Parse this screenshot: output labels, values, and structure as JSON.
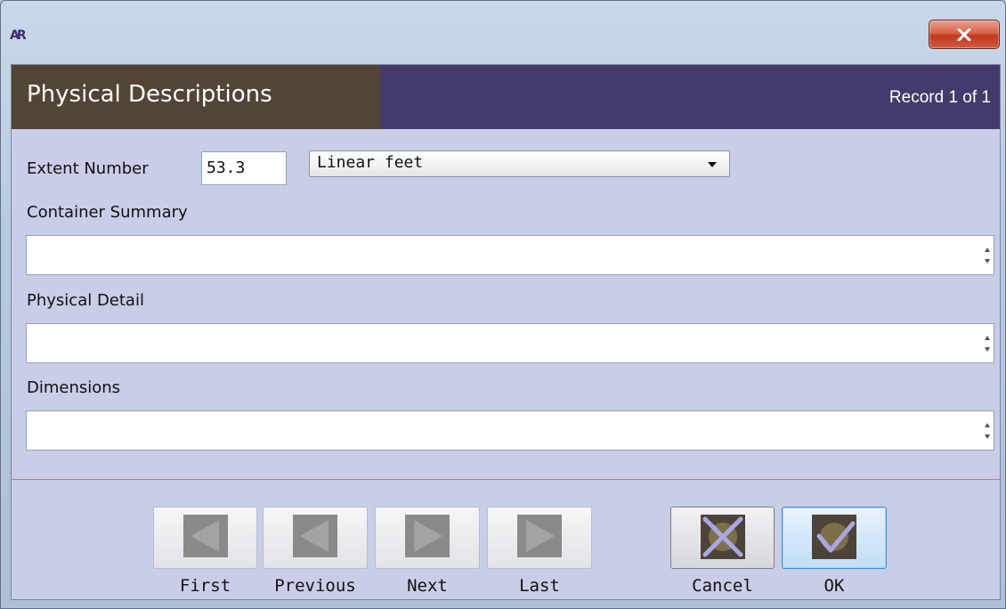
{
  "window": {
    "app_logo_text": "AR",
    "close_icon": "close-x-icon"
  },
  "header": {
    "title": "Physical Descriptions",
    "record_indicator": "Record 1 of 1"
  },
  "form": {
    "extent_number_label": "Extent Number",
    "extent_number_value": "53.3",
    "extent_type_value": "Linear feet",
    "container_summary_label": "Container Summary",
    "container_summary_value": "",
    "physical_detail_label": "Physical Detail",
    "physical_detail_value": "",
    "dimensions_label": "Dimensions",
    "dimensions_value": ""
  },
  "navigation": {
    "first_label": "First",
    "previous_label": "Previous",
    "next_label": "Next",
    "last_label": "Last",
    "cancel_label": "Cancel",
    "ok_label": "OK"
  },
  "colors": {
    "header_left": "#534536",
    "header_right": "#443b6c",
    "dialog_bg": "#c9cde8",
    "close_button": "#c94a30",
    "ok_border": "#3d8fd8"
  }
}
